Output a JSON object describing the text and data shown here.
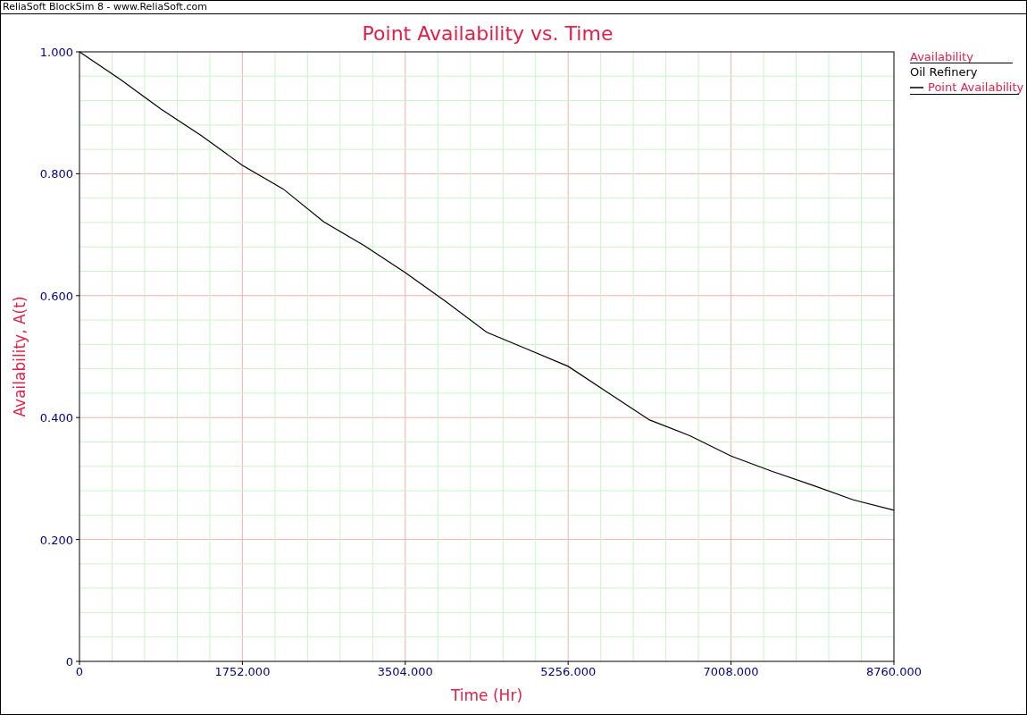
{
  "window": {
    "title": "ReliaSoft BlockSim 8 - www.ReliaSoft.com"
  },
  "chart": {
    "chart_data": {
      "type": "line",
      "title": "Point Availability vs. Time",
      "xlabel": "Time (Hr)",
      "ylabel": "Availability, A(t)",
      "x": [
        0,
        438,
        876,
        1314,
        1752,
        2190,
        2628,
        3066,
        3504,
        3942,
        4380,
        4818,
        5256,
        5694,
        6132,
        6570,
        7008,
        7446,
        7884,
        8322,
        8760
      ],
      "series": [
        {
          "name": "Point Availability",
          "color": "#000000",
          "values": [
            1.0,
            0.955,
            0.906,
            0.862,
            0.814,
            0.775,
            0.721,
            0.682,
            0.638,
            0.59,
            0.54,
            0.512,
            0.484,
            0.44,
            0.396,
            0.37,
            0.337,
            0.312,
            0.289,
            0.265,
            0.248
          ]
        }
      ],
      "xlim": [
        0,
        8760
      ],
      "ylim": [
        0,
        1
      ],
      "grid": true,
      "ref_lines": [
        {
          "axis": "x",
          "value": 350.4,
          "color": "#c8f5c8"
        },
        {
          "axis": "x",
          "value": 700.8,
          "color": "#c8f5c8"
        },
        {
          "axis": "x",
          "value": 1051.2,
          "color": "#c8f5c8"
        },
        {
          "axis": "x",
          "value": 1401.6,
          "color": "#c8f5c8"
        },
        {
          "axis": "x",
          "value": 2102.4,
          "color": "#c8f5c8"
        },
        {
          "axis": "x",
          "value": 2452.8,
          "color": "#c8f5c8"
        },
        {
          "axis": "x",
          "value": 2803.2,
          "color": "#c8f5c8"
        },
        {
          "axis": "x",
          "value": 3153.6,
          "color": "#c8f5c8"
        },
        {
          "axis": "x",
          "value": 3854.4,
          "color": "#c8f5c8"
        },
        {
          "axis": "x",
          "value": 4204.8,
          "color": "#c8f5c8"
        },
        {
          "axis": "x",
          "value": 4555.2,
          "color": "#c8f5c8"
        },
        {
          "axis": "x",
          "value": 4905.6,
          "color": "#c8f5c8"
        },
        {
          "axis": "x",
          "value": 5606.4,
          "color": "#c8f5c8"
        },
        {
          "axis": "x",
          "value": 5956.8,
          "color": "#c8f5c8"
        },
        {
          "axis": "x",
          "value": 6307.2,
          "color": "#c8f5c8"
        },
        {
          "axis": "x",
          "value": 6657.6,
          "color": "#c8f5c8"
        },
        {
          "axis": "x",
          "value": 7358.4,
          "color": "#c8f5c8"
        },
        {
          "axis": "x",
          "value": 7708.8,
          "color": "#c8f5c8"
        },
        {
          "axis": "x",
          "value": 8059.2,
          "color": "#c8f5c8"
        },
        {
          "axis": "x",
          "value": 8409.6,
          "color": "#c8f5c8"
        },
        {
          "axis": "y",
          "value": 0.04,
          "color": "#c8f5c8"
        },
        {
          "axis": "y",
          "value": 0.08,
          "color": "#c8f5c8"
        },
        {
          "axis": "y",
          "value": 0.12,
          "color": "#c8f5c8"
        },
        {
          "axis": "y",
          "value": 0.16,
          "color": "#c8f5c8"
        },
        {
          "axis": "y",
          "value": 0.24,
          "color": "#c8f5c8"
        },
        {
          "axis": "y",
          "value": 0.28,
          "color": "#c8f5c8"
        },
        {
          "axis": "y",
          "value": 0.32,
          "color": "#c8f5c8"
        },
        {
          "axis": "y",
          "value": 0.36,
          "color": "#c8f5c8"
        },
        {
          "axis": "y",
          "value": 0.44,
          "color": "#c8f5c8"
        },
        {
          "axis": "y",
          "value": 0.48,
          "color": "#c8f5c8"
        },
        {
          "axis": "y",
          "value": 0.52,
          "color": "#c8f5c8"
        },
        {
          "axis": "y",
          "value": 0.56,
          "color": "#c8f5c8"
        },
        {
          "axis": "y",
          "value": 0.64,
          "color": "#c8f5c8"
        },
        {
          "axis": "y",
          "value": 0.68,
          "color": "#c8f5c8"
        },
        {
          "axis": "y",
          "value": 0.72,
          "color": "#c8f5c8"
        },
        {
          "axis": "y",
          "value": 0.76,
          "color": "#c8f5c8"
        },
        {
          "axis": "y",
          "value": 0.84,
          "color": "#c8f5c8"
        },
        {
          "axis": "y",
          "value": 0.88,
          "color": "#c8f5c8"
        },
        {
          "axis": "y",
          "value": 0.92,
          "color": "#c8f5c8"
        },
        {
          "axis": "y",
          "value": 0.96,
          "color": "#c8f5c8"
        }
      ],
      "xticks": [
        {
          "value": 0,
          "label": "0"
        },
        {
          "value": 1752,
          "label": "1752.000"
        },
        {
          "value": 3504,
          "label": "3504.000"
        },
        {
          "value": 5256,
          "label": "5256.000"
        },
        {
          "value": 7008,
          "label": "7008.000"
        },
        {
          "value": 8760,
          "label": "8760.000"
        }
      ],
      "yticks": [
        {
          "value": 0,
          "label": "0"
        },
        {
          "value": 0.2,
          "label": "0.200"
        },
        {
          "value": 0.4,
          "label": "0.400"
        },
        {
          "value": 0.6,
          "label": "0.600"
        },
        {
          "value": 0.8,
          "label": "0.800"
        },
        {
          "value": 1,
          "label": "1.000"
        }
      ]
    },
    "legend": {
      "title": "Availability",
      "group": "Oil Refinery"
    }
  }
}
